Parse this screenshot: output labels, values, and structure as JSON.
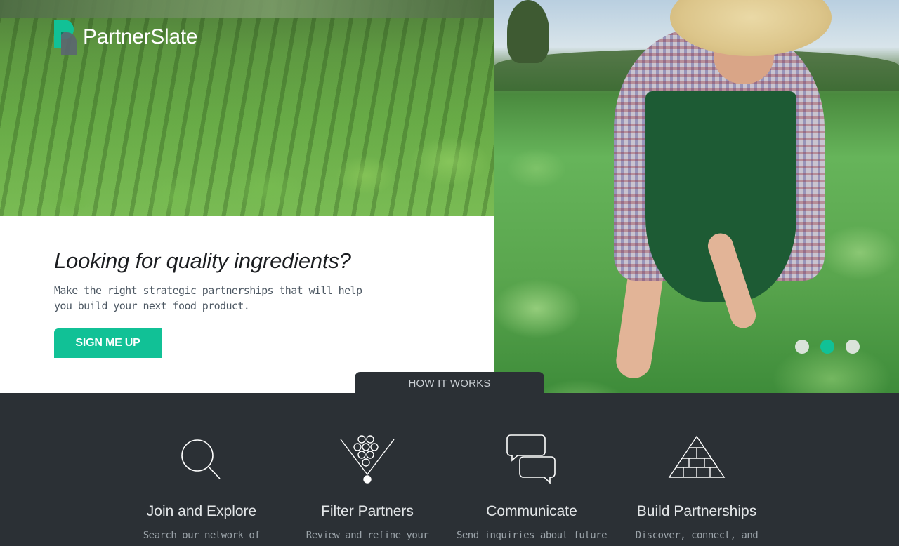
{
  "brand": {
    "name": "PartnerSlate",
    "colors": {
      "accent": "#11c196",
      "dark": "#2b3035",
      "white": "#ffffff"
    }
  },
  "hero": {
    "headline": "Looking for quality ingredients?",
    "subtext": "Make the right strategic partnerships that will help you build your next food product.",
    "cta_label": "SIGN ME UP",
    "carousel": {
      "slides": 3,
      "active_index": 1
    }
  },
  "how_it_works": {
    "tab_label": "HOW IT WORKS",
    "steps": [
      {
        "icon": "magnifier-icon",
        "title": "Join and Explore",
        "desc": "Search our network of"
      },
      {
        "icon": "funnel-icon",
        "title": "Filter Partners",
        "desc": "Review and refine your"
      },
      {
        "icon": "chat-bubbles-icon",
        "title": "Communicate",
        "desc": "Send inquiries about future"
      },
      {
        "icon": "pyramid-icon",
        "title": "Build Partnerships",
        "desc": "Discover, connect, and"
      }
    ]
  }
}
